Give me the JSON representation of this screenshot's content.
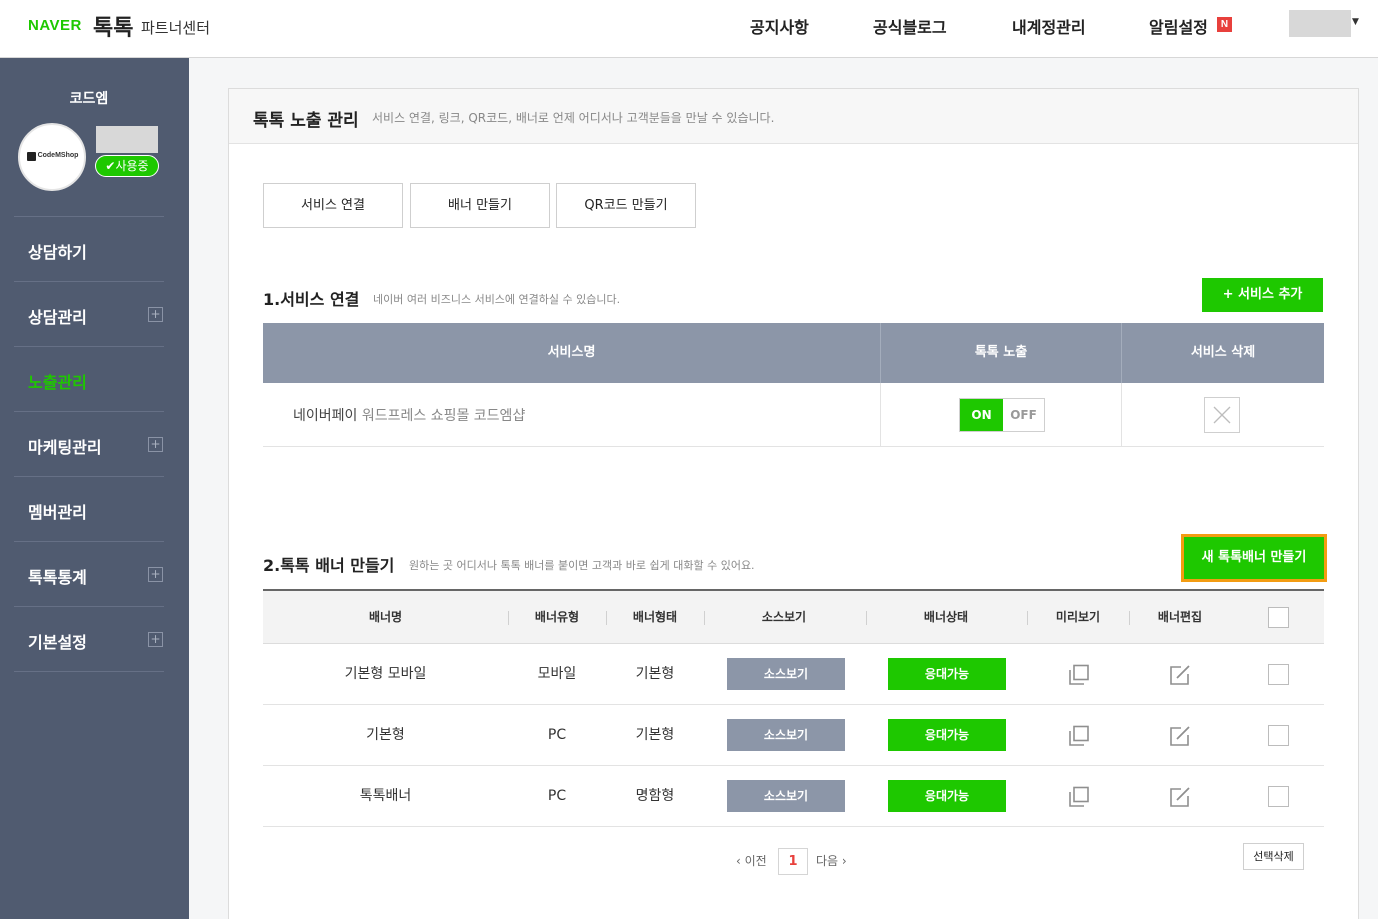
{
  "header": {
    "brand_naver": "NAVER",
    "brand_talk": "톡톡",
    "brand_partner": "파트너센터",
    "nav": [
      "공지사항",
      "공식블로그",
      "내계정관리",
      "알림설정"
    ],
    "new_badge": "N"
  },
  "sidebar": {
    "shop_name": "코드엠",
    "logo_text": "CodeMShop",
    "status": "✔사용중",
    "items": [
      {
        "label": "상담하기",
        "expandable": false
      },
      {
        "label": "상담관리",
        "expandable": true
      },
      {
        "label": "노출관리",
        "expandable": false,
        "active": true
      },
      {
        "label": "마케팅관리",
        "expandable": true
      },
      {
        "label": "멤버관리",
        "expandable": false
      },
      {
        "label": "톡톡통계",
        "expandable": true
      },
      {
        "label": "기본설정",
        "expandable": true
      }
    ],
    "plus_symbol": "+"
  },
  "page": {
    "title": "톡톡 노출 관리",
    "desc": "서비스 연결, 링크, QR코드, 배너로 언제 어디서나 고객분들을 만날 수 있습니다.",
    "tabs": [
      "서비스 연결",
      "배너 만들기",
      "QR코드 만들기"
    ]
  },
  "services": {
    "title": "1.서비스 연결",
    "desc": "네이버 여러 비즈니스 서비스에 연결하실 수 있습니다.",
    "add_button": "+ 서비스 추가",
    "columns": [
      "서비스명",
      "톡톡 노출",
      "서비스 삭제"
    ],
    "row": {
      "name": "네이버페이",
      "sub": "워드프레스 쇼핑몰 코드엠샵",
      "on_label": "ON",
      "off_label": "OFF",
      "state": "on"
    }
  },
  "banners": {
    "title": "2.톡톡 배너 만들기",
    "desc": "원하는 곳 어디서나 톡톡 배너를 붙이면 고객과 바로 쉽게 대화할 수 있어요.",
    "new_button": "새 톡톡배너 만들기",
    "columns": [
      "배너명",
      "배너유형",
      "배너형태",
      "소스보기",
      "배너상태",
      "미리보기",
      "배너편집"
    ],
    "rows": [
      {
        "name": "기본형 모바일",
        "type": "모바일",
        "shape": "기본형",
        "source": "소스보기",
        "state": "응대가능"
      },
      {
        "name": "기본형",
        "type": "PC",
        "shape": "기본형",
        "source": "소스보기",
        "state": "응대가능"
      },
      {
        "name": "톡톡배너",
        "type": "PC",
        "shape": "명함형",
        "source": "소스보기",
        "state": "응대가능"
      }
    ],
    "pager": {
      "prev": "‹ 이전",
      "current": "1",
      "next": "다음 ›"
    },
    "delete_selected": "선택삭제"
  },
  "colors": {
    "accent": "#1ec800",
    "sidebar": "#505b70",
    "table_head": "#8c96a8",
    "highlight": "#f39c12",
    "badge": "#e8403c"
  },
  "icons": [
    "copy-icon",
    "edit-icon",
    "close-icon",
    "check-icon",
    "chevron-down-icon",
    "plus-icon"
  ]
}
